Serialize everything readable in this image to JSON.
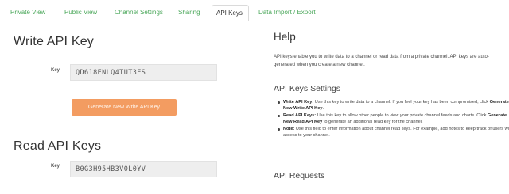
{
  "tabs": [
    {
      "label": "Private View",
      "active": false
    },
    {
      "label": "Public View",
      "active": false
    },
    {
      "label": "Channel Settings",
      "active": false
    },
    {
      "label": "Sharing",
      "active": false
    },
    {
      "label": "API Keys",
      "active": true
    },
    {
      "label": "Data Import / Export",
      "active": false
    }
  ],
  "write": {
    "heading": "Write API Key",
    "label": "Key",
    "value": "QD618ENLQ4TUT3ES",
    "button": "Generate New Write API Key"
  },
  "read": {
    "heading": "Read API Keys",
    "label": "Key",
    "value": "B0G3H95HB3V0L0YV"
  },
  "help": {
    "title": "Help",
    "intro": "API keys enable you to write data to a channel or read data from a private channel. API keys are auto-generated when you create a new channel.",
    "settings_heading": "API Keys Settings",
    "items": [
      {
        "term": "Write API Key:",
        "text": " Use this key to write data to a channel. If you feel your key has been compromised, click ",
        "action": "Generate New Write API Key",
        "end": "."
      },
      {
        "term": "Read API Keys:",
        "text": " Use this key to allow other people to view your private channel feeds and charts. Click ",
        "action": "Generate New Read API Key",
        "end": " to generate an additional read key for the channel."
      },
      {
        "term": "Note:",
        "text": " Use this field to enter information about channel read keys. For example, add notes to keep track of users with access to your channel.",
        "action": "",
        "end": ""
      }
    ],
    "requests_heading": "API Requests"
  },
  "colors": {
    "tab_link": "#4aa75a",
    "button_bg": "#f39c61",
    "key_box_bg": "#eeeeee"
  }
}
